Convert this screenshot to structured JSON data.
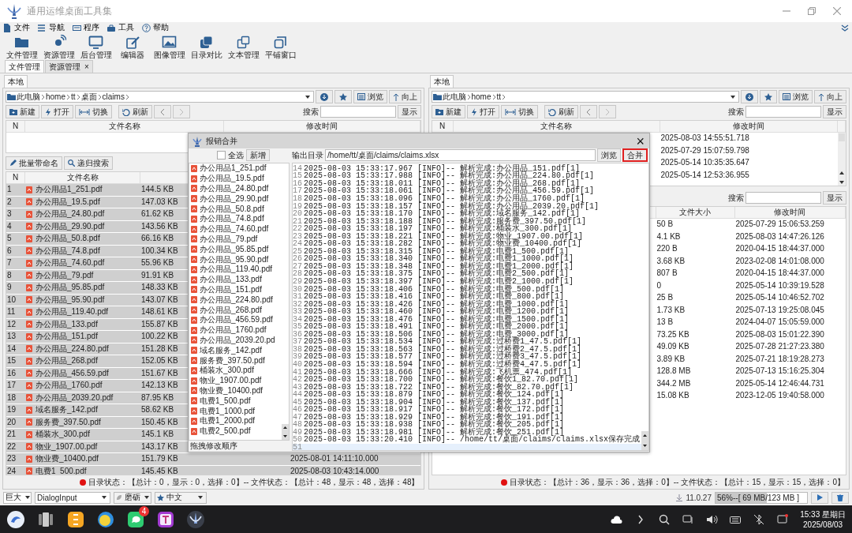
{
  "window": {
    "title": "通用运维桌面工具集"
  },
  "menu": [
    "文件",
    "导航",
    "程序",
    "工具",
    "帮助"
  ],
  "toolbar": [
    "文件管理",
    "资源管理",
    "后台管理",
    "编辑器",
    "图像管理",
    "目录对比",
    "文本管理",
    "平铺窗口"
  ],
  "tabs": [
    {
      "label": "文件管理",
      "selected": true
    },
    {
      "label": "资源管理",
      "selected": false,
      "close": "×"
    }
  ],
  "left_panel": {
    "tab": {
      "label": "本地",
      "selected": true
    },
    "path": [
      "此电脑",
      "home",
      "tt",
      "桌面",
      "claims"
    ],
    "path_buttons": [
      "浏览",
      "向上"
    ],
    "actions": [
      "新建",
      "打开",
      "切换",
      "刷新"
    ],
    "search": {
      "label": "搜索",
      "button": "显示"
    },
    "top_table": {
      "columns": {
        "n": "N",
        "name": "文件名称",
        "modified": "修改时间"
      }
    },
    "tools": [
      "批量带命名",
      "递归搜索"
    ],
    "file_table": {
      "columns": {
        "n": "N",
        "name": "文件名称"
      },
      "rows": [
        {
          "n": "1",
          "name": "办公用品1_251.pdf",
          "size": "144.5 KB",
          "selected": true
        },
        {
          "n": "2",
          "name": "办公用品_19.5.pdf",
          "size": "147.03 KB",
          "selected": true
        },
        {
          "n": "3",
          "name": "办公用品_24.80.pdf",
          "size": "61.62 KB",
          "selected": true
        },
        {
          "n": "4",
          "name": "办公用品_29.90.pdf",
          "size": "143.56 KB",
          "selected": true
        },
        {
          "n": "5",
          "name": "办公用品_50.8.pdf",
          "size": "66.16 KB",
          "selected": true
        },
        {
          "n": "6",
          "name": "办公用品_74.8.pdf",
          "size": "100.34 KB",
          "selected": true
        },
        {
          "n": "7",
          "name": "办公用品_74.60.pdf",
          "size": "55.96 KB",
          "selected": true
        },
        {
          "n": "8",
          "name": "办公用品_79.pdf",
          "size": "91.91 KB",
          "selected": true
        },
        {
          "n": "9",
          "name": "办公用品_95.85.pdf",
          "size": "148.33 KB",
          "selected": true
        },
        {
          "n": "10",
          "name": "办公用品_95.90.pdf",
          "size": "143.07 KB",
          "selected": true
        },
        {
          "n": "11",
          "name": "办公用品_119.40.pdf",
          "size": "148.61 KB",
          "selected": true
        },
        {
          "n": "12",
          "name": "办公用品_133.pdf",
          "size": "155.87 KB",
          "selected": true
        },
        {
          "n": "13",
          "name": "办公用品_151.pdf",
          "size": "100.22 KB",
          "selected": true
        },
        {
          "n": "14",
          "name": "办公用品_224.80.pdf",
          "size": "151.28 KB",
          "selected": true
        },
        {
          "n": "15",
          "name": "办公用品_268.pdf",
          "size": "152.05 KB",
          "selected": true
        },
        {
          "n": "16",
          "name": "办公用品_456.59.pdf",
          "size": "151.67 KB",
          "selected": true
        },
        {
          "n": "17",
          "name": "办公用品_1760.pdf",
          "size": "142.13 KB",
          "selected": true
        },
        {
          "n": "18",
          "name": "办公用品_2039.20.pdf",
          "size": "87.95 KB",
          "selected": true
        },
        {
          "n": "19",
          "name": "域名服务_142.pdf",
          "size": "58.62 KB",
          "selected": true
        },
        {
          "n": "20",
          "name": "服务费_397.50.pdf",
          "size": "150.45 KB",
          "selected": true
        },
        {
          "n": "21",
          "name": "桶装水_300.pdf",
          "size": "145.1 KB",
          "selected": true
        },
        {
          "n": "22",
          "name": "物业_1907.00.pdf",
          "size": "143.17 KB",
          "selected": true
        },
        {
          "n": "23",
          "name": "物业费_10400.pdf",
          "size": "151.79 KB",
          "modified": "2025-08-01 14:11:10.000",
          "selected": true
        },
        {
          "n": "24",
          "name": "电费1_500.pdf",
          "size": "145.45 KB",
          "modified": "2025-08-03 10:43:14.000",
          "selected": true
        }
      ]
    },
    "status": "目录状态：【总计：0，显示：0，选择：0】-- 文件状态：【总计：48，显示：48，选择：48】"
  },
  "right_panel": {
    "tab": {
      "label": "本地",
      "selected": true
    },
    "path": [
      "此电脑",
      "home",
      "tt"
    ],
    "path_buttons": [
      "浏览",
      "向上"
    ],
    "actions": [
      "新建",
      "打开",
      "切换",
      "刷新"
    ],
    "search": {
      "label": "搜索",
      "button": "显示"
    },
    "top_table": {
      "columns": {
        "n": "N",
        "name": "文件名称",
        "modified": "修改时间"
      },
      "rows": [
        {
          "modified": "2025-08-03 14:55:51.718"
        },
        {
          "modified": "2025-07-29 15:07:59.798"
        },
        {
          "modified": "2025-05-14 10:35:35.647"
        },
        {
          "modified": "2025-05-14 12:53:36.955"
        }
      ]
    },
    "lower_search": {
      "label": "搜索",
      "button": "显示"
    },
    "file_table": {
      "columns": {
        "size": "文件大小",
        "modified": "修改时间"
      },
      "rows": [
        {
          "size": "50 B",
          "modified": "2025-07-29 15:06:53.259",
          "selected": false
        },
        {
          "size": "4.1 KB",
          "modified": "2025-08-03 14:47:26.126",
          "selected": false
        },
        {
          "size": "220 B",
          "modified": "2020-04-15 18:44:37.000",
          "selected": false
        },
        {
          "size": "3.68 KB",
          "modified": "2023-02-08 14:01:08.000",
          "selected": false
        },
        {
          "size": "807 B",
          "modified": "2020-04-15 18:44:37.000",
          "selected": false
        },
        {
          "size": "0",
          "modified": "2025-05-14 10:39:19.528",
          "selected": false
        },
        {
          "size": "25 B",
          "modified": "2025-05-14 10:46:52.702",
          "selected": false
        },
        {
          "size": "1.73 KB",
          "modified": "2025-07-13 19:25:08.045",
          "selected": false
        },
        {
          "size": "13 B",
          "modified": "2024-04-07 15:05:59.000",
          "selected": false
        },
        {
          "size": "73.25 KB",
          "modified": "2025-08-03 15:01:22.390",
          "selected": false
        },
        {
          "size": "49.09 KB",
          "modified": "2025-07-28 21:27:23.380",
          "selected": false
        },
        {
          "size": "3.89 KB",
          "modified": "2025-07-21 18:19:28.273",
          "selected": false
        },
        {
          "size": "128.8 MB",
          "modified": "2025-07-13 15:16:25.304",
          "selected": false
        },
        {
          "size": "344.2 MB",
          "modified": "2025-05-14 12:46:44.731",
          "selected": false
        },
        {
          "size": "15.08 KB",
          "modified": "2023-12-05 19:40:58.000",
          "selected": false
        }
      ]
    },
    "status": "目录状态：【总计：36，显示：36，选择：0】-- 文件状态：【总计：15，显示：15，选择：0】"
  },
  "dialog": {
    "title": "报销合并",
    "close": "×",
    "select_all": {
      "label": "全选",
      "checked": false
    },
    "add_button": "新增",
    "files": [
      "办公用品1_251.pdf",
      "办公用品_19.5.pdf",
      "办公用品_24.80.pdf",
      "办公用品_29.90.pdf",
      "办公用品_50.8.pdf",
      "办公用品_74.8.pdf",
      "办公用品_74.60.pdf",
      "办公用品_79.pdf",
      "办公用品_95.85.pdf",
      "办公用品_95.90.pdf",
      "办公用品_119.40.pdf",
      "办公用品_133.pdf",
      "办公用品_151.pdf",
      "办公用品_224.80.pdf",
      "办公用品_268.pdf",
      "办公用品_456.59.pdf",
      "办公用品_1760.pdf",
      "办公用品_2039.20.pd",
      "域名服务_142.pdf",
      "服务费_397.50.pdf",
      "桶装水_300.pdf",
      "物业_1907.00.pdf",
      "物业费_10400.pdf",
      "电费1_500.pdf",
      "电费1_1000.pdf",
      "电费1_2000.pdf",
      "电费2_500.pdf"
    ],
    "hint": "拖拽修改顺序",
    "output_label": "输出目录",
    "output_path": "/home/tt/桌面/claims/claims.xlsx",
    "browse_button": "浏览",
    "merge_button": {
      "label": "合并",
      "highlighted": true
    },
    "log": [
      {
        "n": "14",
        "text": "2025-08-03 15:33:17.967 [INFO]-- 解析完成:办公用品_151.pdf[1]",
        "current": false
      },
      {
        "n": "15",
        "text": "2025-08-03 15:33:17.988 [INFO]-- 解析完成:办公用品_224.80.pdf[1]",
        "current": false
      },
      {
        "n": "16",
        "text": "2025-08-03 15:33:18.011 [INFO]-- 解析完成:办公用品_268.pdf[1]",
        "current": false
      },
      {
        "n": "17",
        "text": "2025-08-03 15:33:18.061 [INFO]-- 解析完成:办公用品_456.59.pdf[1]",
        "current": false
      },
      {
        "n": "18",
        "text": "2025-08-03 15:33:18.096 [INFO]-- 解析完成:办公用品_1760.pdf[1]",
        "current": false
      },
      {
        "n": "19",
        "text": "2025-08-03 15:33:18.157 [INFO]-- 解析完成:办公用品_2039.20.pdf[1]",
        "current": false
      },
      {
        "n": "20",
        "text": "2025-08-03 15:33:18.170 [INFO]-- 解析完成:域名服务_142.pdf[1]",
        "current": false
      },
      {
        "n": "21",
        "text": "2025-08-03 15:33:18.188 [INFO]-- 解析完成:服务费_397.50.pdf[1]",
        "current": false
      },
      {
        "n": "22",
        "text": "2025-08-03 15:33:18.197 [INFO]-- 解析完成:桶装水_300.pdf[1]",
        "current": false
      },
      {
        "n": "23",
        "text": "2025-08-03 15:33:18.221 [INFO]-- 解析完成:物业_1907.00.pdf[1]",
        "current": false
      },
      {
        "n": "24",
        "text": "2025-08-03 15:33:18.282 [INFO]-- 解析完成:物业费_10400.pdf[1]",
        "current": false
      },
      {
        "n": "25",
        "text": "2025-08-03 15:33:18.315 [INFO]-- 解析完成:电费1_500.pdf[1]",
        "current": false
      },
      {
        "n": "26",
        "text": "2025-08-03 15:33:18.340 [INFO]-- 解析完成:电费1_1000.pdf[1]",
        "current": false
      },
      {
        "n": "27",
        "text": "2025-08-03 15:33:18.348 [INFO]-- 解析完成:电费1_2000.pdf[1]",
        "current": false
      },
      {
        "n": "28",
        "text": "2025-08-03 15:33:18.375 [INFO]-- 解析完成:电费2_500.pdf[1]",
        "current": false
      },
      {
        "n": "29",
        "text": "2025-08-03 15:33:18.397 [INFO]-- 解析完成:电费2_1000.pdf[1]",
        "current": false
      },
      {
        "n": "30",
        "text": "2025-08-03 15:33:18.406 [INFO]-- 解析完成:电费_500.pdf[1]",
        "current": false
      },
      {
        "n": "31",
        "text": "2025-08-03 15:33:18.416 [INFO]-- 解析完成:电费_800.pdf[1]",
        "current": false
      },
      {
        "n": "32",
        "text": "2025-08-03 15:33:18.426 [INFO]-- 解析完成:电费_1000.pdf[1]",
        "current": false
      },
      {
        "n": "33",
        "text": "2025-08-03 15:33:18.460 [INFO]-- 解析完成:电费_1200.pdf[1]",
        "current": false
      },
      {
        "n": "34",
        "text": "2025-08-03 15:33:18.476 [INFO]-- 解析完成:电费_1500.pdf[1]",
        "current": false
      },
      {
        "n": "35",
        "text": "2025-08-03 15:33:18.491 [INFO]-- 解析完成:电费_2000.pdf[1]",
        "current": false
      },
      {
        "n": "36",
        "text": "2025-08-03 15:33:18.506 [INFO]-- 解析完成:电费_3000.pdf[1]",
        "current": false
      },
      {
        "n": "37",
        "text": "2025-08-03 15:33:18.534 [INFO]-- 解析完成:过桥费1_47.5.pdf[1]",
        "current": false
      },
      {
        "n": "38",
        "text": "2025-08-03 15:33:18.563 [INFO]-- 解析完成:过桥费2_47.5.pdf[1]",
        "current": false
      },
      {
        "n": "39",
        "text": "2025-08-03 15:33:18.577 [INFO]-- 解析完成:过桥费3_47.5.pdf[1]",
        "current": false
      },
      {
        "n": "40",
        "text": "2025-08-03 15:33:18.594 [INFO]-- 解析完成:过桥费4_47.5.pdf[1]",
        "current": false
      },
      {
        "n": "41",
        "text": "2025-08-03 15:33:18.666 [INFO]-- 解析完成:飞机票_474.pdf[1]",
        "current": false
      },
      {
        "n": "42",
        "text": "2025-08-03 15:33:18.700 [INFO]-- 解析完成:餐饮1_82.70.pdf[1]",
        "current": false
      },
      {
        "n": "43",
        "text": "2025-08-03 15:33:18.722 [INFO]-- 解析完成:餐饮_82.70.pdf[1]",
        "current": false
      },
      {
        "n": "44",
        "text": "2025-08-03 15:33:18.879 [INFO]-- 解析完成:餐饮_124.pdf[1]",
        "current": false
      },
      {
        "n": "45",
        "text": "2025-08-03 15:33:18.904 [INFO]-- 解析完成:餐饮_137.pdf[1]",
        "current": false
      },
      {
        "n": "46",
        "text": "2025-08-03 15:33:18.917 [INFO]-- 解析完成:餐饮_172.pdf[1]",
        "current": false
      },
      {
        "n": "47",
        "text": "2025-08-03 15:33:18.929 [INFO]-- 解析完成:餐饮_191.pdf[1]",
        "current": false
      },
      {
        "n": "48",
        "text": "2025-08-03 15:33:18.938 [INFO]-- 解析完成:餐饮_205.pdf[1]",
        "current": false
      },
      {
        "n": "49",
        "text": "2025-08-03 15:33:18.981 [INFO]-- 解析完成:餐饮_251.pdf[1]",
        "current": false
      },
      {
        "n": "50",
        "text": "2025-08-03 15:33:20.410 [INFO]-- /home/tt/桌面/claims/claims.xlsx保存完成",
        "current": false
      },
      {
        "n": "51",
        "current": true
      }
    ]
  },
  "bottom_bar": {
    "size_select": "巨大",
    "font_select": "DialogInput",
    "theme_select": "磨砺",
    "language_select": "中文",
    "version": "11.0.27",
    "memory": {
      "text": "56%--[ 69 MB/123 MB ]",
      "level": 0.56
    }
  },
  "taskbar": {
    "chat_badge": "4",
    "time": "15:33 星期日",
    "date": "2025/08/03"
  }
}
